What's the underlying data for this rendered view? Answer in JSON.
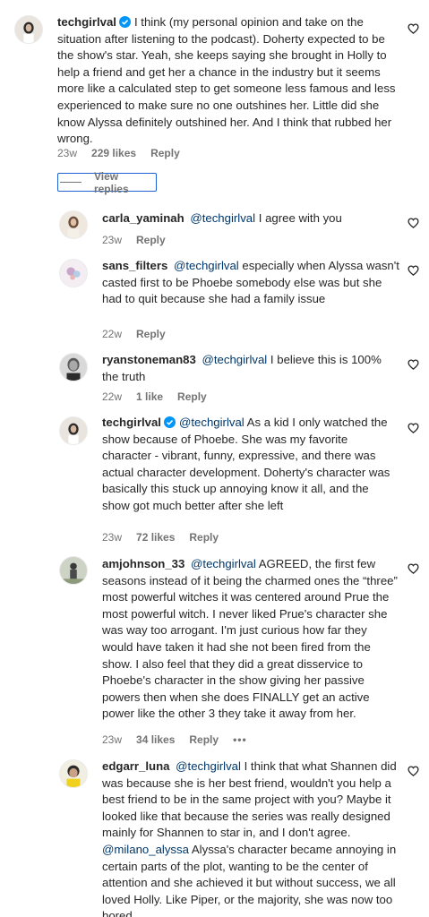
{
  "comments": [
    {
      "username": "techgirlval",
      "verified": true,
      "mention": "",
      "text": "I think (my personal opinion and take on the situation after listening to the podcast). Doherty expected to be the show's star. Yeah, she keeps saying she brought in Holly to help a friend and get her a chance in the industry but it seems more like a calculated step to get someone less famous and less experienced to make sure no one outshines her. Little did she know Alyssa definitely outshined her. And I think that rubbed her wrong.",
      "time": "23w",
      "likes": "229 likes",
      "reply": "Reply"
    },
    {
      "username": "carla_yaminah",
      "verified": false,
      "mention": "@techgirlval",
      "text": "I agree with you",
      "time": "23w",
      "likes": "",
      "reply": "Reply"
    },
    {
      "username": "sans_filters",
      "verified": false,
      "mention": "@techgirlval",
      "text": "especially when Alyssa wasn't casted first to be Phoebe somebody else was but she had to quit because she had a family issue",
      "time": "22w",
      "likes": "",
      "reply": "Reply"
    },
    {
      "username": "ryanstoneman83",
      "verified": false,
      "mention": "@techgirlval",
      "text": "I believe this is 100% the truth",
      "time": "22w",
      "likes": "1 like",
      "reply": "Reply"
    },
    {
      "username": "techgirlval",
      "verified": true,
      "mention": "@techgirlval",
      "text": "As a kid I only watched the show because of Phoebe. She was my favorite character - vibrant, funny, expressive, and there was actual character development. Doherty's character was basically this stuck up annoying know it all, and the show got much better after she left",
      "time": "23w",
      "likes": "72 likes",
      "reply": "Reply"
    },
    {
      "username": "amjohnson_33",
      "verified": false,
      "mention": "@techgirlval",
      "text": "AGREED, the first few seasons instead of it being the charmed ones the “three” most powerful witches it was centered around Prue the most powerful witch. I never liked Prue's character she was way too arrogant. I'm just curious how far they would have taken it had she not been fired from the show. I also feel that they did a great disservice to Phoebe's character in the show giving her passive powers then when she does FINALLY get an active power like the other 3 they take it away from her.",
      "time": "23w",
      "likes": "34 likes",
      "reply": "Reply",
      "more": "•••"
    },
    {
      "username": "edgarr_luna",
      "verified": false,
      "mention": "@techgirlval",
      "text": "I think that what Shannen did was because she is her best friend, wouldn't you help a best friend to be in the same project with you? Maybe it looked like that because the series was really designed mainly for Shannen to star in, and I don't agree.",
      "mention2": "@milano_alyssa",
      "text2": "Alyssa's character became annoying in certain parts of the plot, wanting to be the center of attention and she achieved it but without success, we all loved Holly. Like Piper, or the majority, she was now too bored",
      "time": "",
      "likes": "",
      "reply": ""
    }
  ],
  "view_replies_label": "View replies",
  "colors": {
    "mention": "#00376b",
    "verified": "#0095f6",
    "meta": "#737373"
  }
}
